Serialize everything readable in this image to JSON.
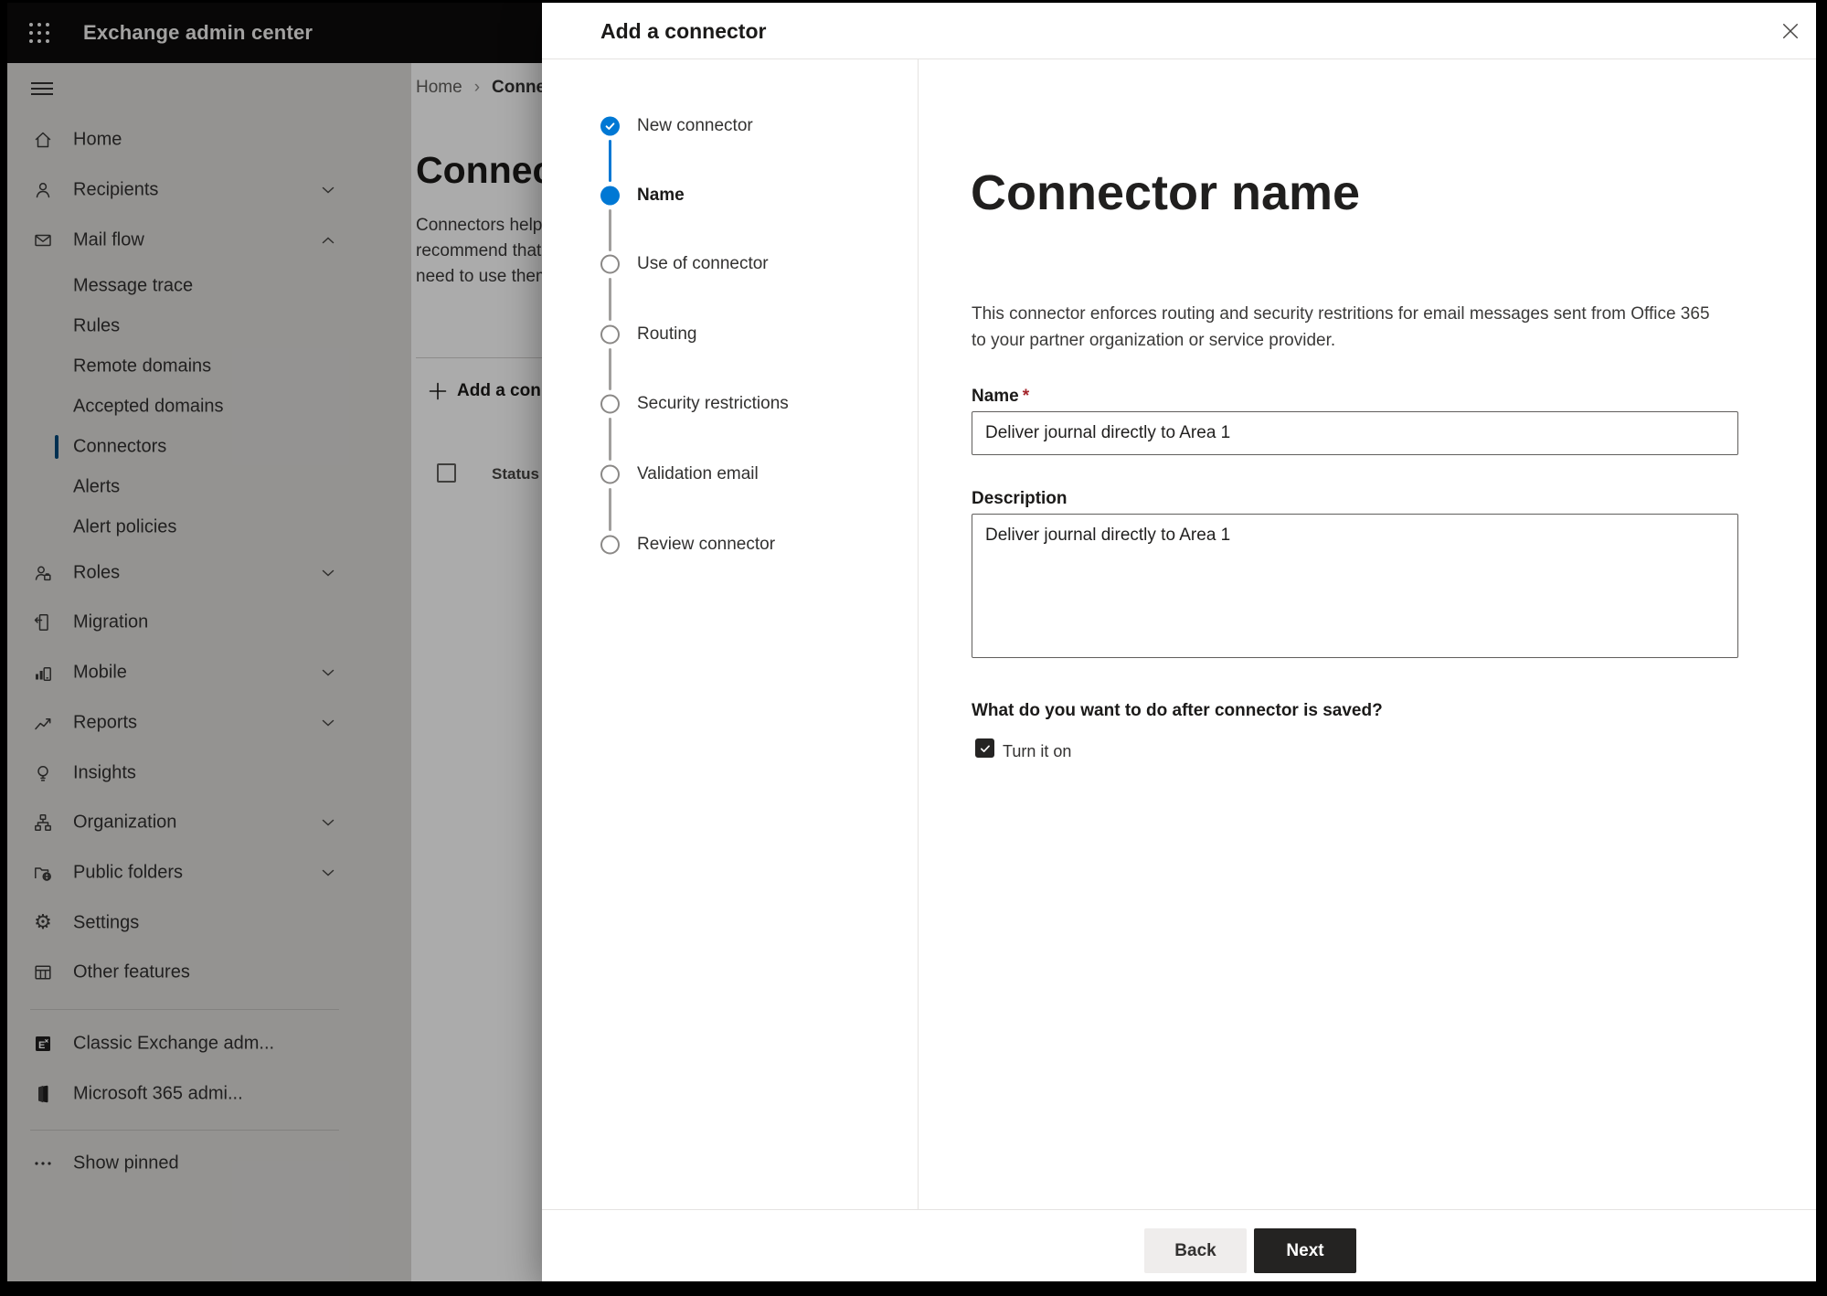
{
  "colors": {
    "accent": "#0078d4",
    "topbar_bg": "#0c0b0b",
    "required_red": "#a4262c",
    "next_button_bg": "#242322",
    "overlay": "rgba(0,0,0,0.33)"
  },
  "topbar": {
    "title": "Exchange admin center"
  },
  "sidebar": {
    "items": [
      {
        "label": "Home"
      },
      {
        "label": "Recipients"
      },
      {
        "label": "Mail flow"
      },
      {
        "label": "Message trace"
      },
      {
        "label": "Rules"
      },
      {
        "label": "Remote domains"
      },
      {
        "label": "Accepted domains"
      },
      {
        "label": "Connectors",
        "selected": true
      },
      {
        "label": "Alerts"
      },
      {
        "label": "Alert policies"
      },
      {
        "label": "Roles"
      },
      {
        "label": "Migration"
      },
      {
        "label": "Mobile"
      },
      {
        "label": "Reports"
      },
      {
        "label": "Insights"
      },
      {
        "label": "Organization"
      },
      {
        "label": "Public folders"
      },
      {
        "label": "Settings"
      },
      {
        "label": "Other features"
      },
      {
        "label": "Classic Exchange adm..."
      },
      {
        "label": "Microsoft 365 admi..."
      },
      {
        "label": "Show pinned"
      }
    ]
  },
  "page": {
    "breadcrumb": {
      "home": "Home",
      "separator": "›",
      "current": "Connectors"
    },
    "heading": "Connectors",
    "intro_lines": [
      "Connectors help",
      "recommend that",
      "need to use them"
    ],
    "add_button": "Add a connector",
    "table": {
      "status_header": "Status"
    }
  },
  "modal": {
    "title": "Add a connector",
    "steps": [
      {
        "label": "New connector",
        "state": "completed"
      },
      {
        "label": "Name",
        "state": "current"
      },
      {
        "label": "Use of connector",
        "state": "upcoming"
      },
      {
        "label": "Routing",
        "state": "upcoming"
      },
      {
        "label": "Security restrictions",
        "state": "upcoming"
      },
      {
        "label": "Validation email",
        "state": "upcoming"
      },
      {
        "label": "Review connector",
        "state": "upcoming"
      }
    ],
    "content": {
      "heading": "Connector name",
      "description_lines": [
        "This connector enforces routing and security restritions for email messages sent from Office 365",
        "to your partner organization or service provider."
      ],
      "name_label": "Name",
      "required_marker": "*",
      "name_value": "Deliver journal directly to Area 1",
      "description_label": "Description",
      "description_value": "Deliver journal directly to Area 1",
      "after_save_question": "What do you want to do after connector is saved?",
      "turn_on_label": "Turn it on",
      "turn_on_checked": true
    },
    "footer": {
      "back": "Back",
      "next": "Next"
    }
  }
}
